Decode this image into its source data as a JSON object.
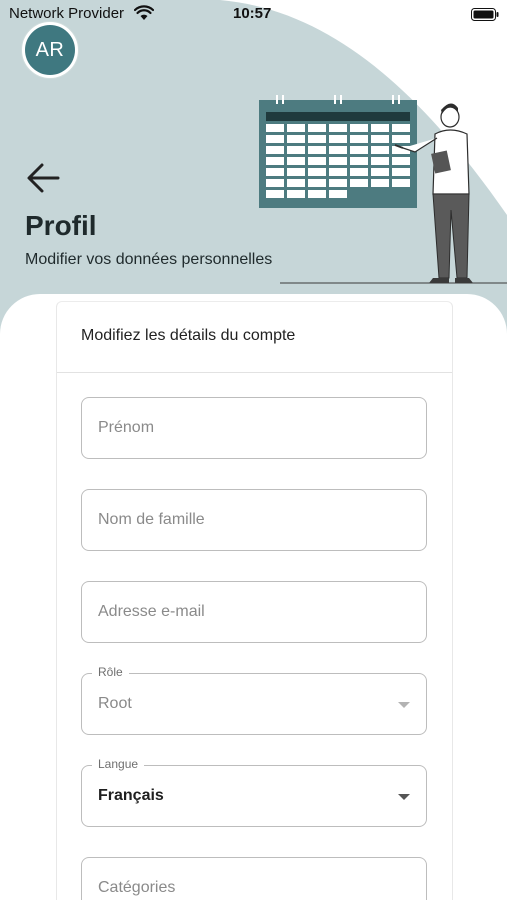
{
  "status_bar": {
    "carrier": "Network Provider",
    "time": "10:57",
    "wifi_icon": "wifi-icon",
    "battery_icon": "battery-icon"
  },
  "avatar": {
    "initials": "AR"
  },
  "header": {
    "back_icon": "arrow-left-icon",
    "title": "Profil",
    "subtitle": "Modifier vos données personnelles",
    "illustration": "calendar-person-illustration"
  },
  "card": {
    "title": "Modifiez les détails du compte"
  },
  "form": {
    "first_name": {
      "placeholder": "Prénom",
      "value": ""
    },
    "last_name": {
      "placeholder": "Nom de famille",
      "value": ""
    },
    "email": {
      "placeholder": "Adresse e-mail",
      "value": ""
    },
    "role": {
      "label": "Rôle",
      "value": "Root",
      "disabled": true
    },
    "language": {
      "label": "Langue",
      "value": "Français"
    },
    "categories": {
      "placeholder": "Catégories",
      "value": ""
    }
  },
  "colors": {
    "header_bg": "#c6d6d8",
    "accent": "#3f7880",
    "calendar": "#4d7b80"
  }
}
